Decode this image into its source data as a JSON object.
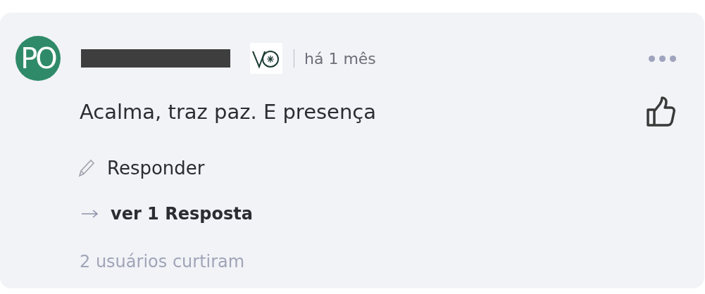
{
  "comment": {
    "avatar": {
      "initials": "PO",
      "color": "#2f8a6a"
    },
    "time": "há 1 mês",
    "text": "Acalma, traz paz. E presença",
    "liked": false,
    "reply_label": "Responder",
    "view_replies": "ver 1 Resposta",
    "likes": "2 usuários curtiram"
  }
}
